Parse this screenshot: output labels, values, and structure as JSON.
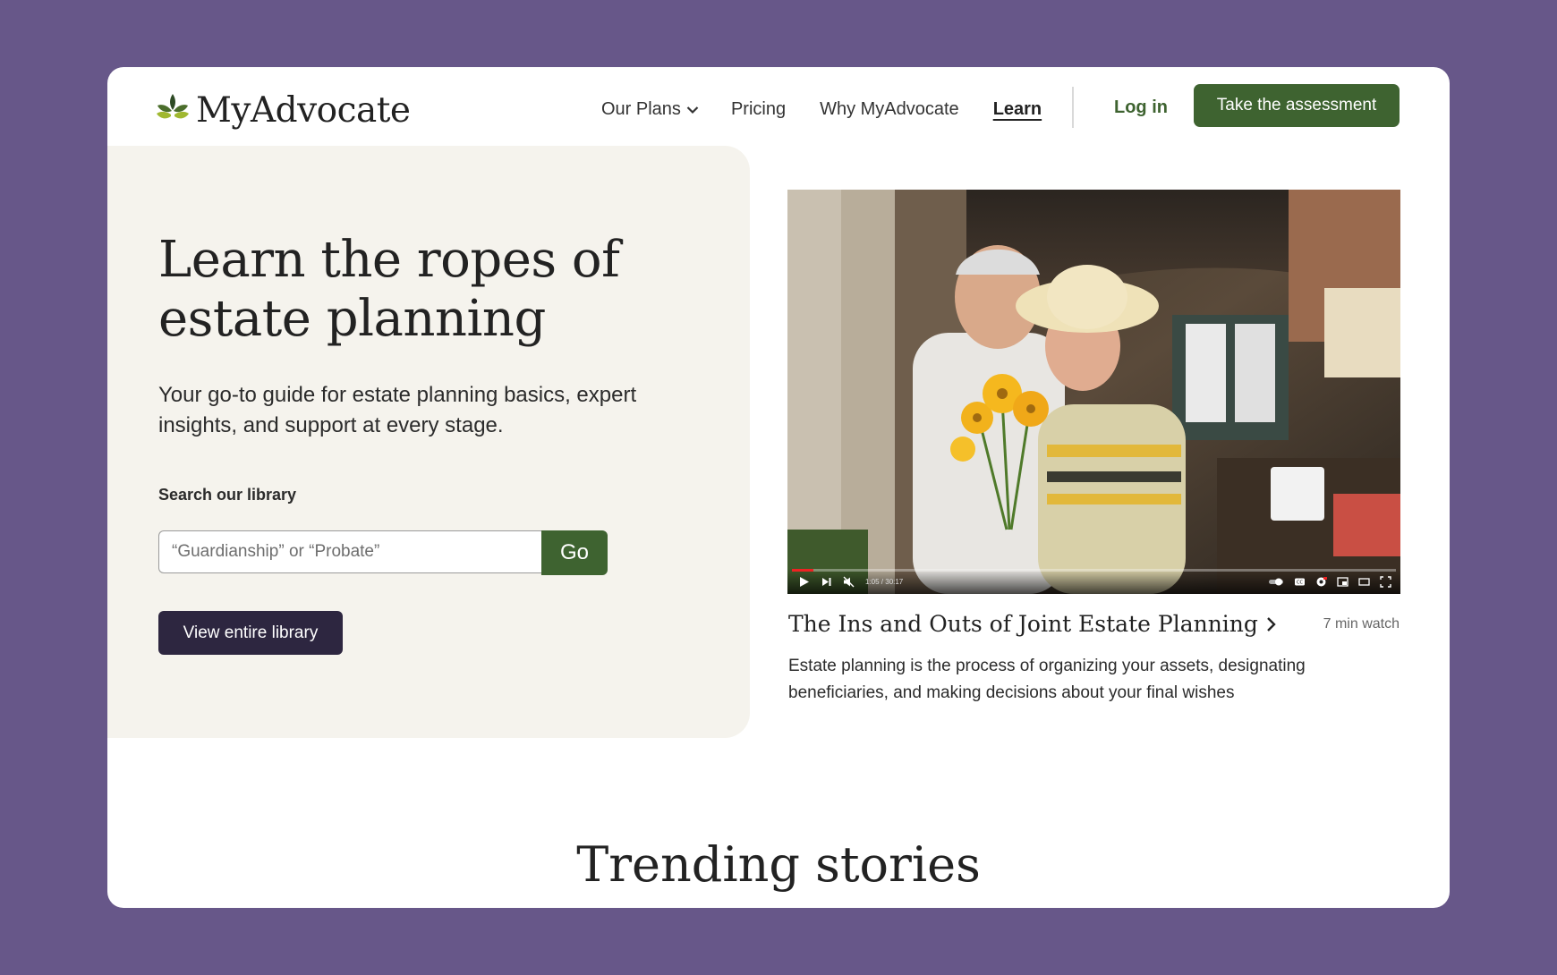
{
  "header": {
    "brand": "MyAdvocate",
    "nav": {
      "plans": "Our Plans",
      "pricing": "Pricing",
      "why": "Why MyAdvocate",
      "learn": "Learn"
    },
    "login": "Log in",
    "cta": "Take the assessment"
  },
  "hero": {
    "title": "Learn the ropes of estate planning",
    "subtitle": "Your go-to guide for estate planning basics, expert insights, and support at every stage.",
    "search_label": "Search our library",
    "search_placeholder": "“Guardianship” or “Probate”",
    "go_label": "Go",
    "library_button": "View entire library"
  },
  "video": {
    "time": "1:05 / 30:17",
    "progress": 0.035,
    "title": "The Ins and Outs of Joint Estate Planning",
    "duration": "7 min watch",
    "description": "Estate planning is the process of organizing your assets, designating beneficiaries, and making decisions about your final wishes"
  },
  "trending_title": "Trending stories",
  "colors": {
    "page_background": "#675789",
    "brand_green": "#3e6330",
    "dark_button": "#2d2640",
    "hero_background": "#f5f3ed"
  }
}
